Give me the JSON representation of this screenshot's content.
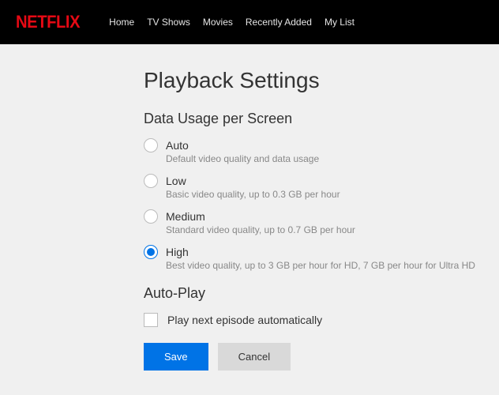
{
  "brand": "NETFLIX",
  "nav": {
    "home": "Home",
    "tvshows": "TV Shows",
    "movies": "Movies",
    "recent": "Recently Added",
    "mylist": "My List"
  },
  "page_title": "Playback Settings",
  "data_usage": {
    "section_title": "Data Usage per Screen",
    "options": [
      {
        "label": "Auto",
        "desc": "Default video quality and data usage",
        "selected": false
      },
      {
        "label": "Low",
        "desc": "Basic video quality, up to 0.3 GB per hour",
        "selected": false
      },
      {
        "label": "Medium",
        "desc": "Standard video quality, up to 0.7 GB per hour",
        "selected": false
      },
      {
        "label": "High",
        "desc": "Best video quality, up to 3 GB per hour for HD, 7 GB per hour for Ultra HD",
        "selected": true
      }
    ]
  },
  "autoplay": {
    "section_title": "Auto-Play",
    "checkbox_label": "Play next episode automatically",
    "checked": false
  },
  "buttons": {
    "save": "Save",
    "cancel": "Cancel"
  }
}
